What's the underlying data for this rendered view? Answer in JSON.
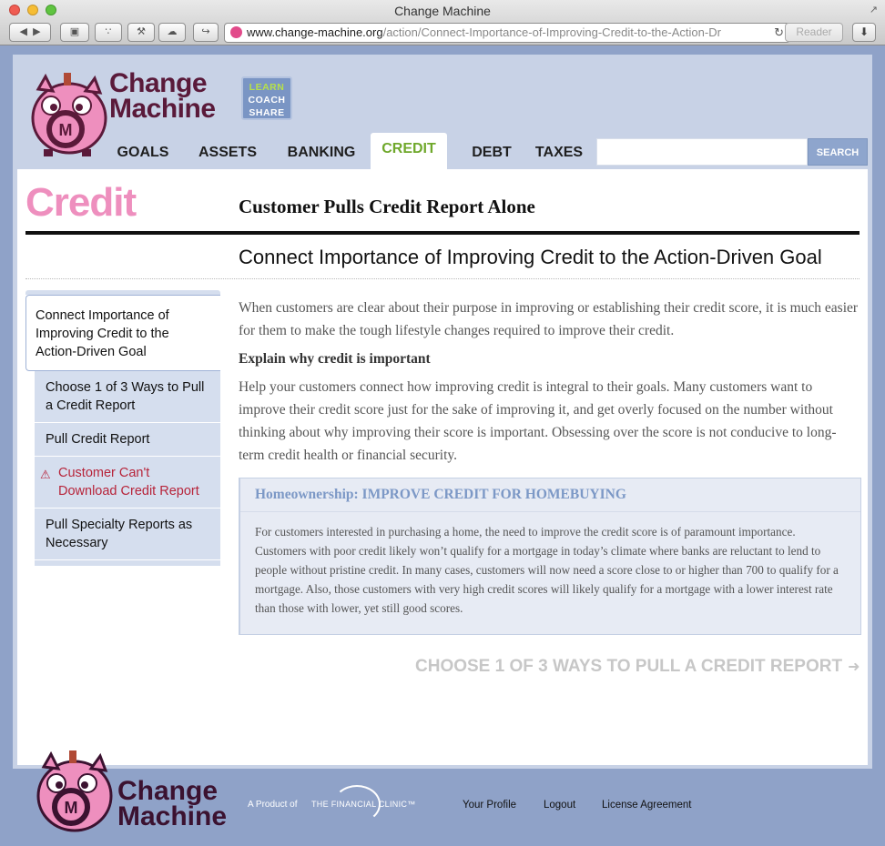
{
  "browser": {
    "window_title": "Change Machine",
    "url_domain": "www.change-machine.org",
    "url_path": "/action/Connect-Importance-of-Improving-Credit-to-the-Action-Dr",
    "reader_label": "Reader"
  },
  "header": {
    "logo_line1": "Change",
    "logo_line2": "Machine",
    "tagline": [
      "LEARN",
      "COACH",
      "SHARE"
    ],
    "nav": [
      "GOALS",
      "ASSETS",
      "BANKING",
      "CREDIT",
      "DEBT",
      "TAXES"
    ],
    "active_nav": "CREDIT",
    "search_button": "SEARCH",
    "search_placeholder": ""
  },
  "content": {
    "section_title": "Credit",
    "step_title": "Customer Pulls Credit Report Alone",
    "sub_title": "Connect Importance of Improving Credit to the Action-Driven Goal",
    "sidebar": [
      "Connect Importance of Improving Credit to the Action-Driven Goal",
      "Choose 1 of 3 Ways to Pull a Credit Report",
      "Pull Credit Report",
      "Customer Can't Download Credit Report",
      "Pull Specialty Reports as Necessary"
    ],
    "intro": "When customers are clear about their purpose in improving or establishing their credit score, it is much easier for them to make the tough lifestyle changes required to improve their credit.",
    "subhead": "Explain why credit is important",
    "body": "Help your customers connect how improving credit is integral to their goals. Many customers want to improve their credit score just for the sake of improving it, and get overly focused on the number without thinking about why improving their score is important. Obsessing over the score is not conducive to long-term credit health or financial security.",
    "callout_title": "Homeownership: IMPROVE CREDIT FOR HOMEBUYING",
    "callout_body": "For customers interested in purchasing a home, the need to improve the credit score is of paramount importance. Customers with poor credit likely won’t qualify for a mortgage in today’s climate where banks are reluctant to lend to people without pristine credit. In many cases, customers will now need a score close to or higher than 700 to qualify for a mortgage. Also, those customers with very high credit scores will likely qualify for a mortgage with a lower interest rate than those with lower, yet still good scores.",
    "next_link": "CHOOSE 1 OF 3 WAYS TO PULL A CREDIT REPORT"
  },
  "footer": {
    "logo_line1": "Change",
    "logo_line2": "Machine",
    "product_of": "A Product of",
    "clinic": "THE FINANCIAL CLINIC™",
    "links": [
      "Your Profile",
      "Logout",
      "License Agreement"
    ]
  },
  "colors": {
    "accent_pink": "#ee8fbe",
    "nav_active_green": "#6fa82b",
    "page_blue": "#c8d2e6",
    "warning_red": "#b7243a"
  }
}
